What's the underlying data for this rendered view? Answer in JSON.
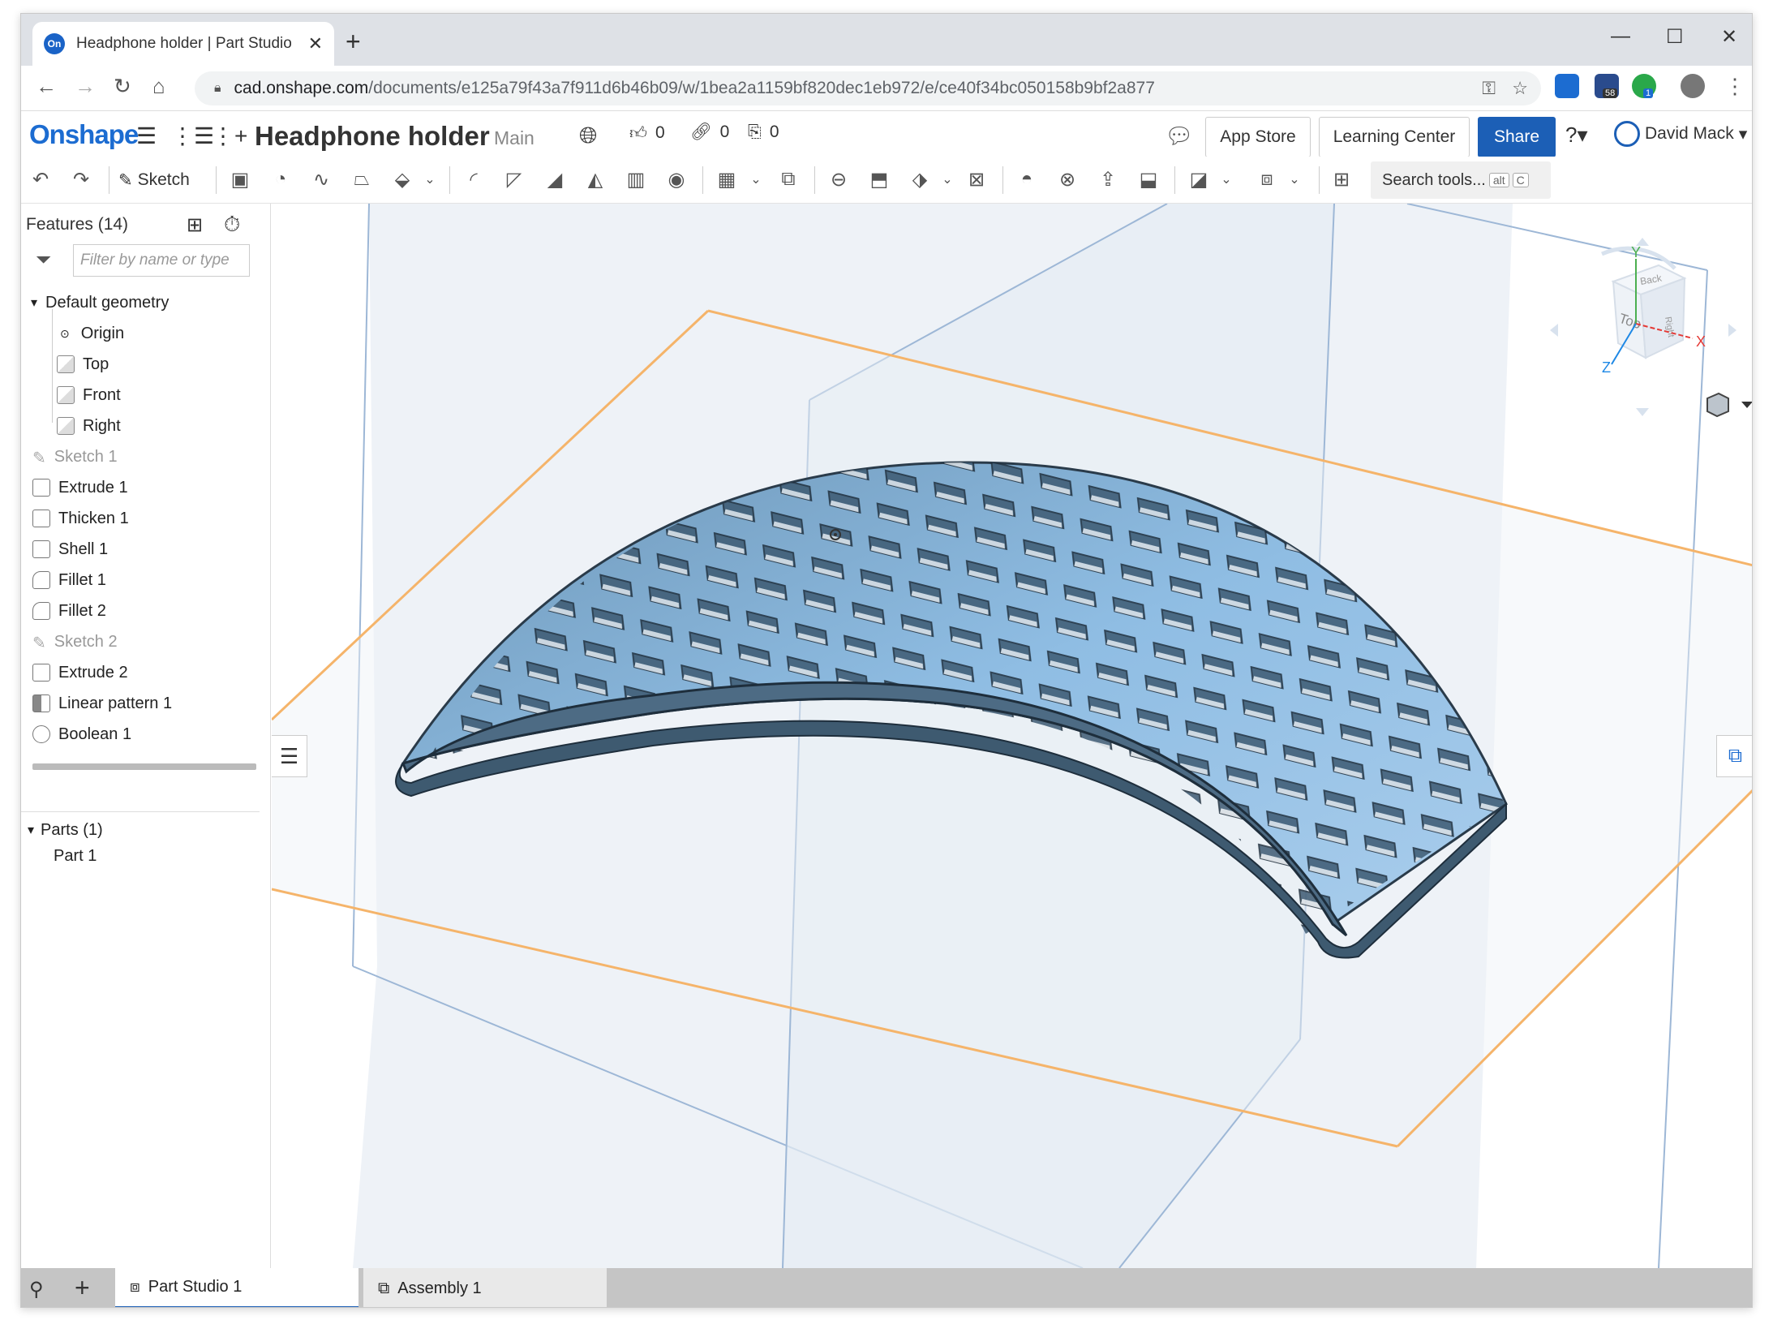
{
  "browser": {
    "tab_title": "Headphone holder | Part Studio 1",
    "favicon_text": "On",
    "url_host": "cad.onshape.com",
    "url_path": "/documents/e125a79f43a7f911d6b46b09/w/1bea2a1159bf820dec1eb972/e/ce40f34bc050158b9bf2a877",
    "ext_badge_1": "58",
    "ext_badge_2": "1"
  },
  "header": {
    "logo": "Onshape",
    "doc_title": "Headphone holder",
    "branch": "Main",
    "likes": "0",
    "links": "0",
    "copies": "0",
    "app_store": "App Store",
    "learning_center": "Learning Center",
    "share": "Share",
    "user_name": "David Mack"
  },
  "toolbar": {
    "sketch_label": "Sketch",
    "search_placeholder": "Search tools...",
    "kbd_alt": "alt",
    "kbd_c": "C"
  },
  "features": {
    "title": "Features (14)",
    "filter_placeholder": "Filter by name or type",
    "default_geometry": "Default geometry",
    "items": [
      {
        "label": "Origin"
      },
      {
        "label": "Top"
      },
      {
        "label": "Front"
      },
      {
        "label": "Right"
      },
      {
        "label": "Sketch 1"
      },
      {
        "label": "Extrude 1"
      },
      {
        "label": "Thicken 1"
      },
      {
        "label": "Shell 1"
      },
      {
        "label": "Fillet 1"
      },
      {
        "label": "Fillet 2"
      },
      {
        "label": "Sketch 2"
      },
      {
        "label": "Extrude 2"
      },
      {
        "label": "Linear pattern 1"
      },
      {
        "label": "Boolean 1"
      }
    ],
    "parts_title": "Parts (1)",
    "parts": [
      {
        "label": "Part 1"
      }
    ]
  },
  "viewcube": {
    "face_top": "Top",
    "face_back": "Back",
    "face_right": "Right",
    "axis_x": "X",
    "axis_y": "Y",
    "axis_z": "Z"
  },
  "bottom_tabs": [
    {
      "label": "Part Studio 1"
    },
    {
      "label": "Assembly 1"
    }
  ],
  "colors": {
    "brand_blue": "#1c5fb6",
    "part_blue": "#8fbde3",
    "top_plane": "#f5b46a",
    "side_plane": "#9db7d6"
  }
}
